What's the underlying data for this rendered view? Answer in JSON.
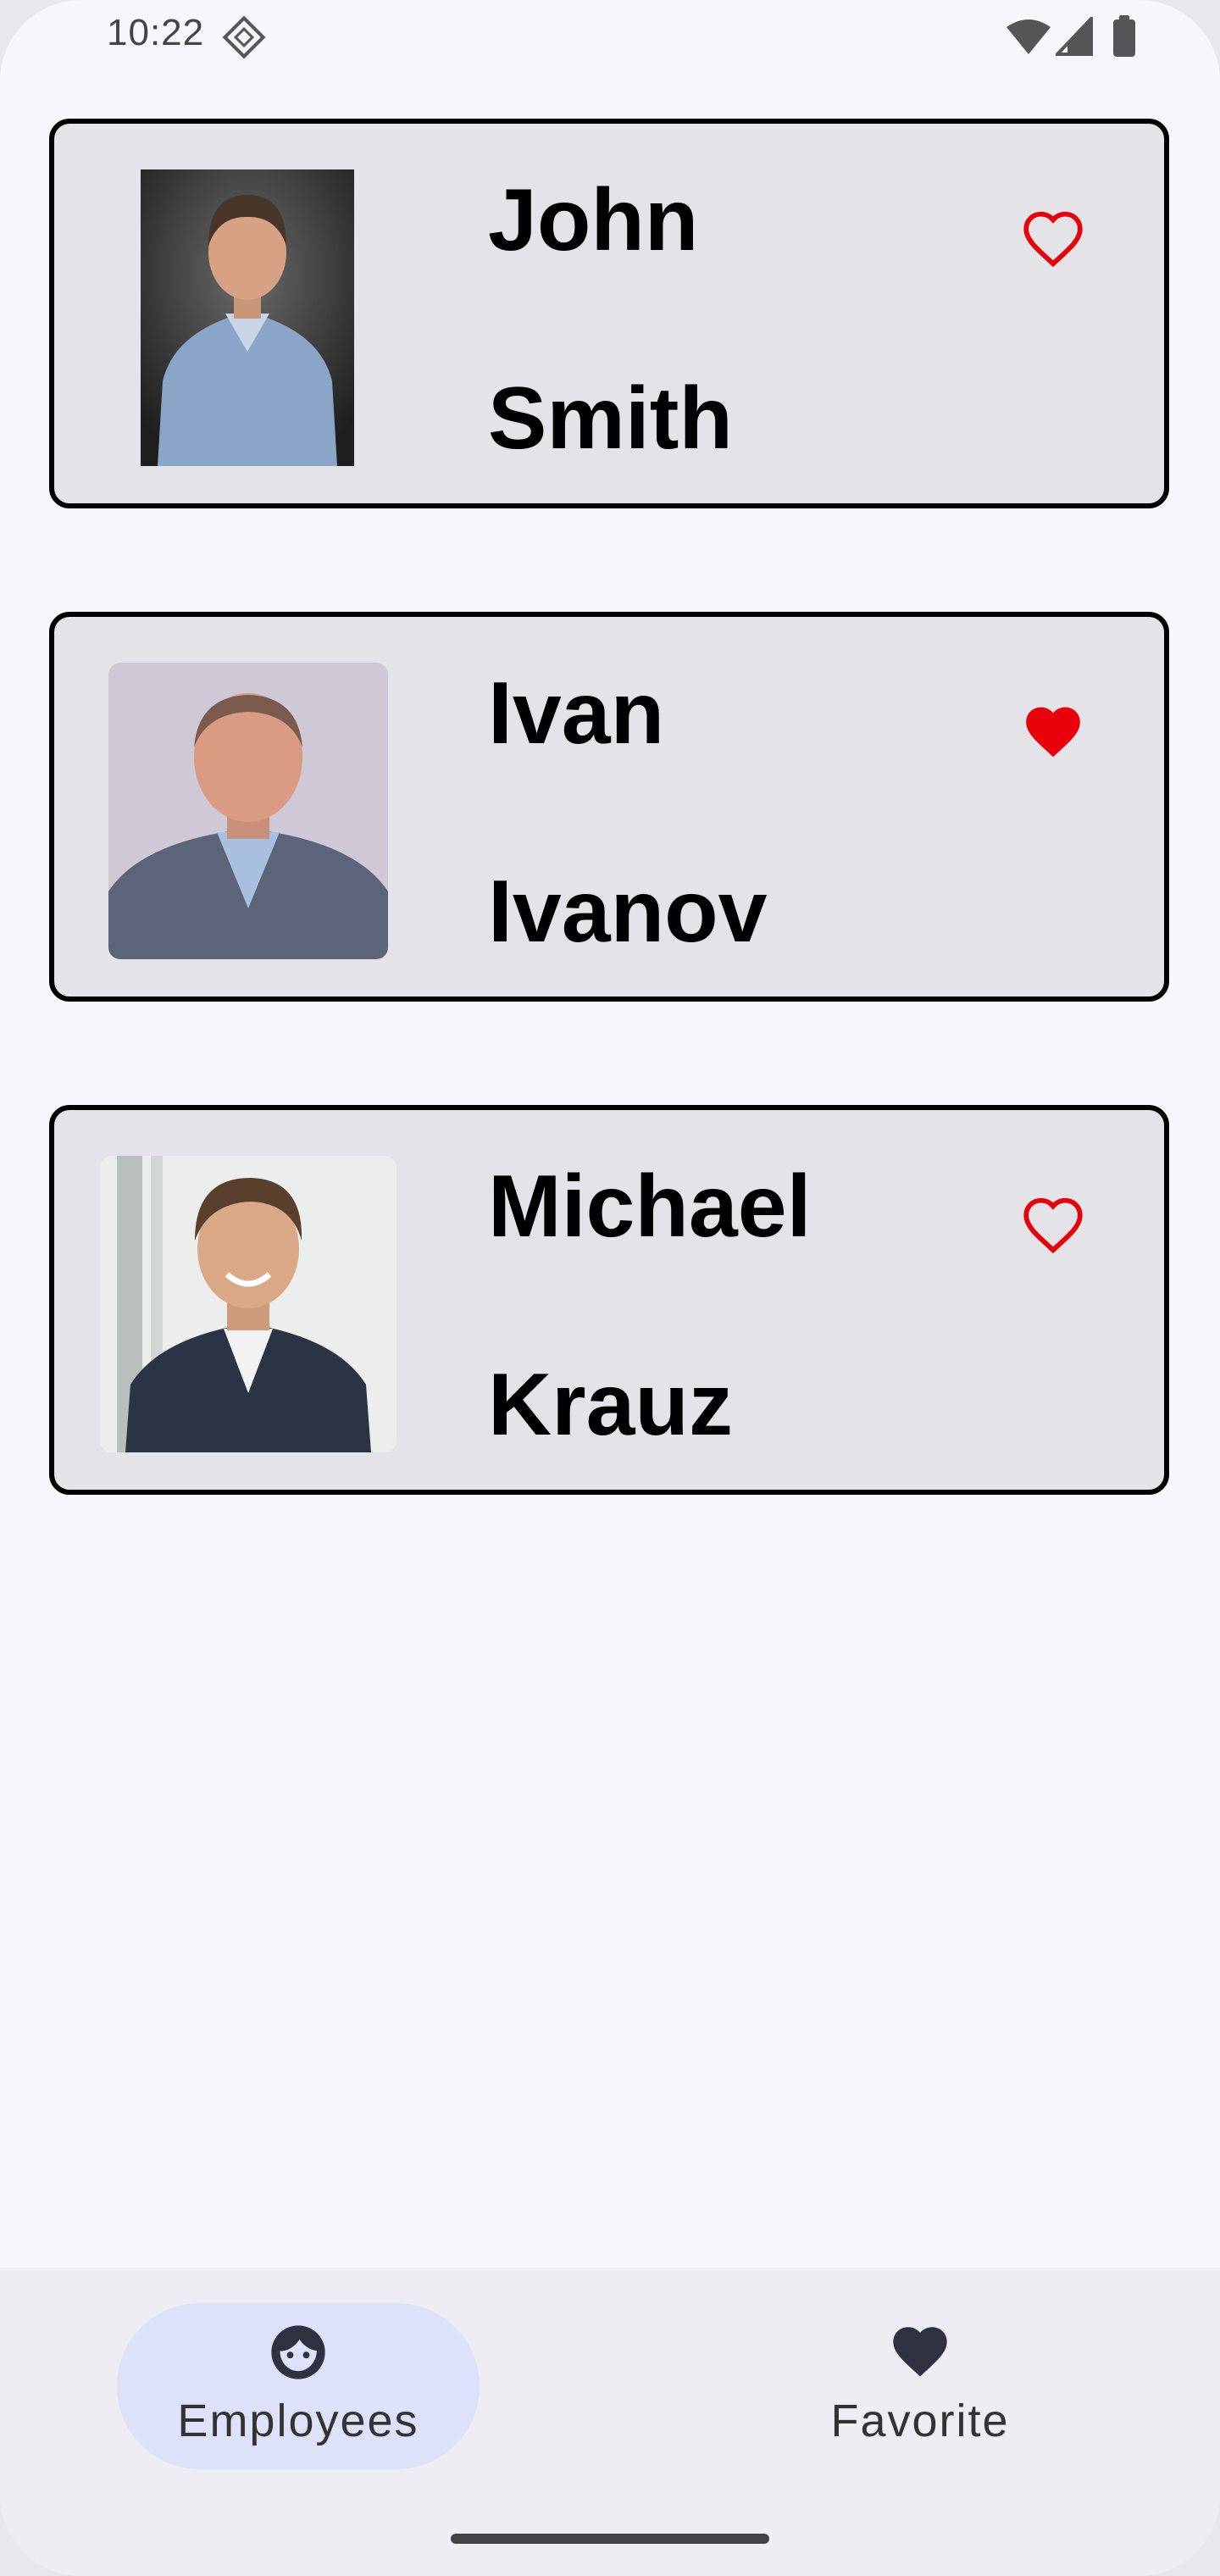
{
  "status_bar": {
    "time": "10:22"
  },
  "employees": [
    {
      "first_name": "John",
      "last_name": "Smith",
      "favorite": false,
      "photo": "man-in-blue-shirt-photo"
    },
    {
      "first_name": "Ivan",
      "last_name": "Ivanov",
      "favorite": true,
      "photo": "older-man-in-gray-suit-photo"
    },
    {
      "first_name": "Michael",
      "last_name": "Krauz",
      "favorite": false,
      "photo": "smiling-man-in-dark-jacket-photo"
    }
  ],
  "bottom_nav": {
    "items": [
      {
        "label": "Employees",
        "icon": "face-icon",
        "active": true
      },
      {
        "label": "Favorite",
        "icon": "heart-icon",
        "active": false
      }
    ]
  },
  "colors": {
    "background": "#f7f6fc",
    "card": "#e3e3e8",
    "heart": "#e8000a",
    "nav_active_pill": "#dde1f9",
    "nav_bar": "#ededf3"
  }
}
